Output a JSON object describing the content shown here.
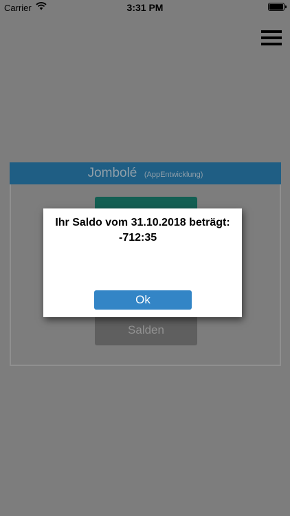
{
  "status_bar": {
    "carrier": "Carrier",
    "time": "3:31 PM"
  },
  "card": {
    "title": "Jombolé",
    "subtitle": "(AppEntwicklung)",
    "salden_label": "Salden"
  },
  "dialog": {
    "message_line1": "Ihr Saldo vom 31.10.2018 beträgt:",
    "message_line2": "-712:35",
    "ok_label": "Ok"
  },
  "colors": {
    "background_overlay": "#7d7d7d",
    "card_header": "#1f5e84",
    "primary_button": "#3385c6",
    "top_button": "#135f53",
    "salden_button": "#5f5f5f"
  }
}
